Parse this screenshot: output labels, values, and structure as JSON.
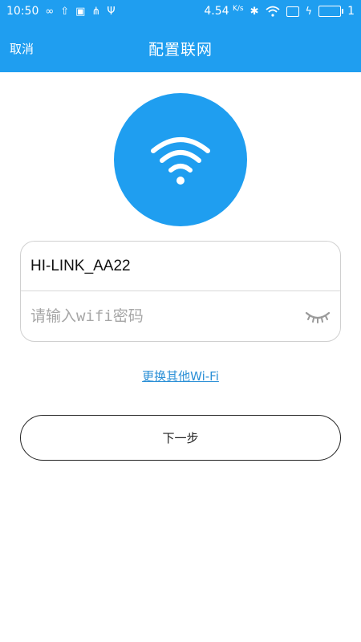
{
  "statusbar": {
    "time": "10:50",
    "speed": "4.54",
    "speed_unit": "K/s",
    "battery_level": "1",
    "icons_left": [
      "infinity-icon",
      "upload-icon",
      "image-icon",
      "share-icon",
      "usb-icon"
    ],
    "icons_right": [
      "bluetooth-icon",
      "wifi-status-icon",
      "screen-icon",
      "charging-icon",
      "battery-icon"
    ]
  },
  "nav": {
    "cancel": "取消",
    "title": "配置联网"
  },
  "form": {
    "ssid": "HI-LINK_AA22",
    "password_value": "",
    "password_placeholder": "请输入wifi密码"
  },
  "links": {
    "change_wifi": "更换其他Wi-Fi"
  },
  "buttons": {
    "next": "下一步"
  },
  "colors": {
    "primary": "#1f9ef0",
    "link": "#2a8fd6",
    "border": "#d0d0d0"
  }
}
